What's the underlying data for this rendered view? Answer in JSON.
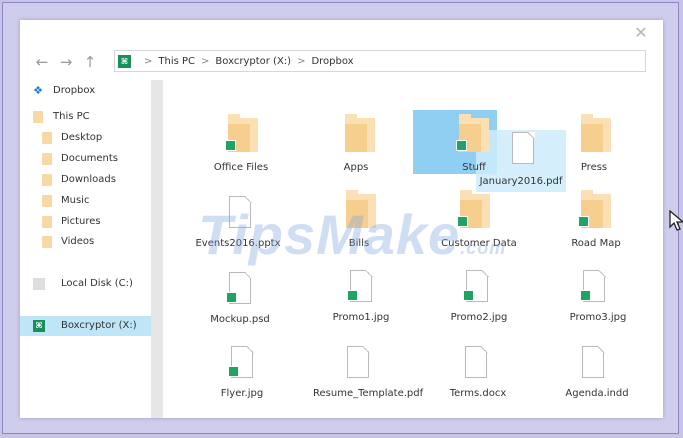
{
  "window": {
    "close_glyph": "✕"
  },
  "nav": {
    "back_glyph": "←",
    "forward_glyph": "→",
    "up_glyph": "↑",
    "breadcrumb": [
      "This PC",
      "Boxcryptor (X:)",
      "Dropbox"
    ],
    "sep_glyph": ">"
  },
  "sidebar": {
    "items": [
      {
        "label": "Dropbox",
        "icon": "dropbox-icon"
      },
      {
        "label": "This PC",
        "icon": "folder-icon"
      },
      {
        "label": "Desktop",
        "icon": "folder-icon"
      },
      {
        "label": "Documents",
        "icon": "folder-icon"
      },
      {
        "label": "Downloads",
        "icon": "folder-icon"
      },
      {
        "label": "Music",
        "icon": "folder-icon"
      },
      {
        "label": "Pictures",
        "icon": "folder-icon"
      },
      {
        "label": "Videos",
        "icon": "folder-icon"
      },
      {
        "label": "Local Disk (C:)",
        "icon": "disk-icon"
      },
      {
        "label": "Boxcryptor (X:)",
        "icon": "boxcryptor-icon",
        "selected": true
      }
    ]
  },
  "items": [
    {
      "label": "Office Files",
      "type": "folder",
      "encrypted": true
    },
    {
      "label": "Apps",
      "type": "folder",
      "encrypted": false
    },
    {
      "label": "Stuff",
      "type": "folder",
      "encrypted": true,
      "selected": true
    },
    {
      "label": "Press",
      "type": "folder",
      "encrypted": false
    },
    {
      "label": "Events2016.pptx",
      "type": "file",
      "encrypted": false
    },
    {
      "label": "Bills",
      "type": "folder",
      "encrypted": false
    },
    {
      "label": "Customer Data",
      "type": "folder",
      "encrypted": true
    },
    {
      "label": "Road Map",
      "type": "folder",
      "encrypted": true
    },
    {
      "label": "Mockup.psd",
      "type": "file",
      "encrypted": true
    },
    {
      "label": "Promo1.jpg",
      "type": "file",
      "encrypted": true
    },
    {
      "label": "Promo2.jpg",
      "type": "file",
      "encrypted": true
    },
    {
      "label": "Promo3.jpg",
      "type": "file",
      "encrypted": true
    },
    {
      "label": "Flyer.jpg",
      "type": "file",
      "encrypted": true
    },
    {
      "label": "Resume_Template.pdf",
      "type": "file",
      "encrypted": false
    },
    {
      "label": "Terms.docx",
      "type": "file",
      "encrypted": false
    },
    {
      "label": "Agenda.indd",
      "type": "file",
      "encrypted": false
    }
  ],
  "drag": {
    "label": "January2016.pdf"
  },
  "watermark": {
    "text": "TipsMake",
    "suffix": ".com"
  },
  "colors": {
    "badge": "#22a366",
    "selection": "#7cc7ee",
    "folder": "#f6cf8f",
    "sidebar_selected": "#bfe6f7"
  }
}
